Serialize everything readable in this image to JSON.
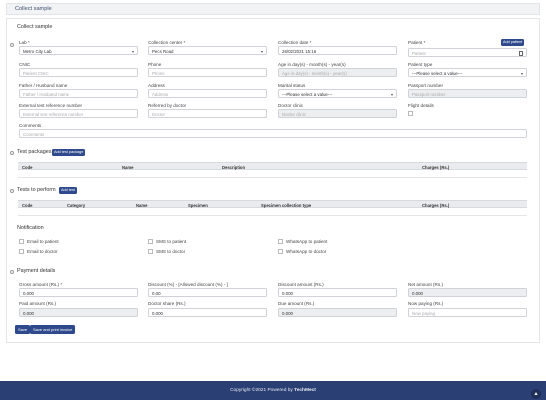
{
  "page": {
    "title": "Collect sample"
  },
  "collect": {
    "title": "Collect sample",
    "lab": {
      "label": "Lab *",
      "value": "Metro City Lab"
    },
    "center": {
      "label": "Collection center *",
      "value": "Pecs Road"
    },
    "date": {
      "label": "Collection date *",
      "value": "26/02/2021 15:16"
    },
    "patient": {
      "label": "Patient *",
      "placeholder": "Patient",
      "add_btn": "Add patient"
    },
    "cnic": {
      "label": "CNIC",
      "placeholder": "Patient CNIC"
    },
    "phone": {
      "label": "Phone",
      "placeholder": "Phone"
    },
    "age": {
      "label": "Age in day(s) - month(s) - year(s)",
      "placeholder": "Age in day(s) - month(s) - year(s)"
    },
    "ptype": {
      "label": "Patient type",
      "value": "---Please select a value---"
    },
    "father": {
      "label": "Father / Husband name",
      "placeholder": "Father / Husband name"
    },
    "address": {
      "label": "Address",
      "placeholder": "Address"
    },
    "marital": {
      "label": "Marital status",
      "value": "---Please select a value---"
    },
    "passport": {
      "label": "Passport number",
      "placeholder": "Passport number"
    },
    "extref": {
      "label": "External test reference number",
      "placeholder": "External test reference number"
    },
    "referred": {
      "label": "Referred by doctor",
      "placeholder": "Doctor"
    },
    "clinic": {
      "label": "Doctor clinic",
      "placeholder": "Doctor clinic"
    },
    "flight": {
      "label": "Flight details"
    },
    "comments": {
      "label": "Comments",
      "placeholder": "Comments"
    }
  },
  "packages": {
    "title": "Test packages",
    "add_btn": "Add test package",
    "cols": {
      "code": "Code",
      "name": "Name",
      "desc": "Description",
      "charges": "Charges (Rs.)"
    }
  },
  "tests": {
    "title": "Tests to perform",
    "add_btn": "Add test",
    "cols": {
      "code": "Code",
      "category": "Category",
      "name": "Name",
      "specimen": "Specimen",
      "spec_type": "Specimen collection type",
      "charges": "Charges (Rs.)"
    }
  },
  "notification": {
    "title": "Notification",
    "email_patient": "Email to patient",
    "email_doctor": "Email to doctor",
    "sms_patient": "SMS to patient",
    "sms_doctor": "SMS to doctor",
    "wa_patient": "WhatsApp to patient",
    "wa_doctor": "WhatsApp to doctor"
  },
  "payment": {
    "title": "Payment details",
    "gross": {
      "label": "Gross amount (Rs.) *",
      "value": "0.000"
    },
    "discount_pct": {
      "label": "Discount (%) - [Allowed discount (%) - ]",
      "value": "0.00"
    },
    "discount_amt": {
      "label": "Discount amount (Rs.)",
      "value": "0.000"
    },
    "net": {
      "label": "Net amount (Rs.)",
      "value": "0.000"
    },
    "paid": {
      "label": "Paid amount (Rs.)",
      "value": "0.000"
    },
    "doctor_share": {
      "label": "Doctor share (Rs.)",
      "value": "0.000"
    },
    "due": {
      "label": "Due amount (Rs.)",
      "value": "0.000"
    },
    "now_paying": {
      "label": "Now paying (Rs.)",
      "placeholder": "Now paying"
    }
  },
  "actions": {
    "save": "Save",
    "save_print": "Save and print invoice"
  },
  "footer": {
    "text": "Copyright ©2021 Powered by ",
    "brand": "TechMect"
  },
  "icons": {
    "scroll_top": "chevron-up-icon",
    "trash": "trash-icon",
    "select": "chevron-down-icon"
  },
  "colors": {
    "primary": "#2e4a8c",
    "footer": "#2a3f74"
  }
}
